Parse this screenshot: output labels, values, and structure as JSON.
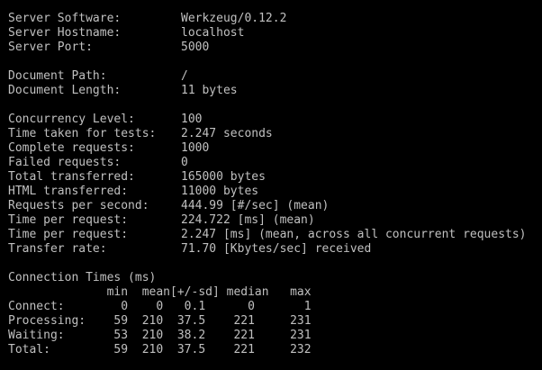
{
  "server": [
    {
      "label": "Server Software:",
      "value": "Werkzeug/0.12.2"
    },
    {
      "label": "Server Hostname:",
      "value": "localhost"
    },
    {
      "label": "Server Port:",
      "value": "5000"
    }
  ],
  "document": [
    {
      "label": "Document Path:",
      "value": "/"
    },
    {
      "label": "Document Length:",
      "value": "11 bytes"
    }
  ],
  "stats": [
    {
      "label": "Concurrency Level:",
      "value": "100"
    },
    {
      "label": "Time taken for tests:",
      "value": "2.247 seconds"
    },
    {
      "label": "Complete requests:",
      "value": "1000"
    },
    {
      "label": "Failed requests:",
      "value": "0"
    },
    {
      "label": "Total transferred:",
      "value": "165000 bytes"
    },
    {
      "label": "HTML transferred:",
      "value": "11000 bytes"
    },
    {
      "label": "Requests per second:",
      "value": "444.99 [#/sec] (mean)"
    },
    {
      "label": "Time per request:",
      "value": "224.722 [ms] (mean)"
    },
    {
      "label": "Time per request:",
      "value": "2.247 [ms] (mean, across all concurrent requests)"
    },
    {
      "label": "Transfer rate:",
      "value": "71.70 [Kbytes/sec] received"
    }
  ],
  "connection_times": {
    "title": "Connection Times (ms)",
    "header": "              min  mean[+/-sd] median   max",
    "rows": [
      "Connect:        0    0   0.1      0       1",
      "Processing:    59  210  37.5    221     231",
      "Waiting:       53  210  38.2    221     231",
      "Total:         59  210  37.5    221     232"
    ]
  },
  "colors": {
    "background": "#000000",
    "text": "#c0c0c0"
  }
}
